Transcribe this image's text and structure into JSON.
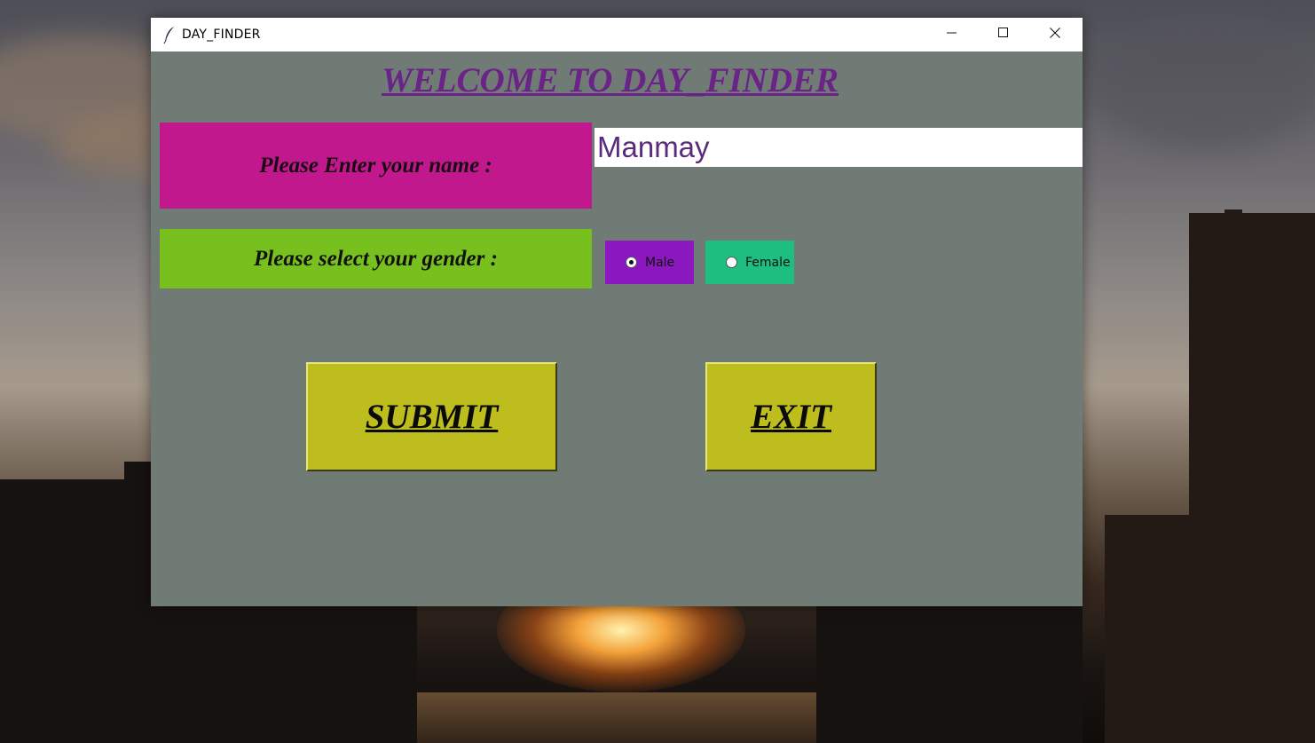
{
  "window": {
    "title": "DAY_FINDER",
    "icon": "feather-icon",
    "controls": [
      "minimize-icon",
      "maximize-icon",
      "close-icon"
    ]
  },
  "main": {
    "heading": "WELCOME TO DAY_FINDER",
    "name_label": "Please Enter your name :",
    "name_value": "Manmay",
    "gender_label": "Please select your gender :",
    "gender_options": [
      "Male",
      "Female"
    ],
    "gender_selected": "Male",
    "submit_label": "SUBMIT",
    "exit_label": "EXIT"
  },
  "colors": {
    "window_bg": "#717b75",
    "heading": "#6a2386",
    "name_label_bg": "#c1198d",
    "gender_label_bg": "#78c01d",
    "male_bg": "#8a18be",
    "female_bg": "#1dbe80",
    "button_bg": "#bdbe1d",
    "input_text": "#5c2a7c"
  }
}
